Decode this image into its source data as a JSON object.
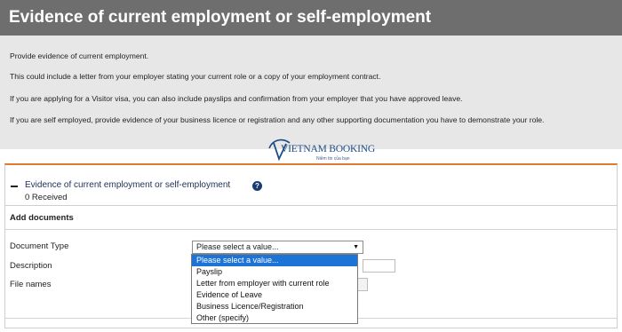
{
  "header": {
    "title": "Evidence of current employment or self-employment"
  },
  "intro": {
    "lines": [
      "Provide evidence of current employment.",
      "This could include a letter from your employer stating your current role or a copy of your employment contract.",
      "If you are applying for a Visitor visa, you can also include payslips and confirmation from your employer that you have approved leave.",
      "If you are self employed, provide evidence of your business licence or registration and any other supporting documentation you have to demonstrate your role."
    ]
  },
  "watermark": {
    "brand": "VIETNAM BOOKING",
    "tagline": "Niềm tin của bạn"
  },
  "section": {
    "title": "Evidence of current employment or self-employment",
    "help_symbol": "?",
    "received": "0 Received"
  },
  "add_documents": {
    "heading": "Add documents",
    "document_type_label": "Document Type",
    "description_label": "Description",
    "file_names_label": "File names",
    "select_value": "Please select a value...",
    "options": [
      "Please select a value...",
      "Payslip",
      "Letter from employer with current role",
      "Evidence of Leave",
      "Business Licence/Registration",
      "Other (specify)"
    ]
  },
  "colors": {
    "accent": "#e07a2e",
    "header_bg": "#6e6e6e",
    "selected_option": "#1e74d6"
  },
  "icons": {
    "collapse": "minus-icon",
    "help": "help-icon",
    "select_arrow": "chevron-down-icon"
  }
}
